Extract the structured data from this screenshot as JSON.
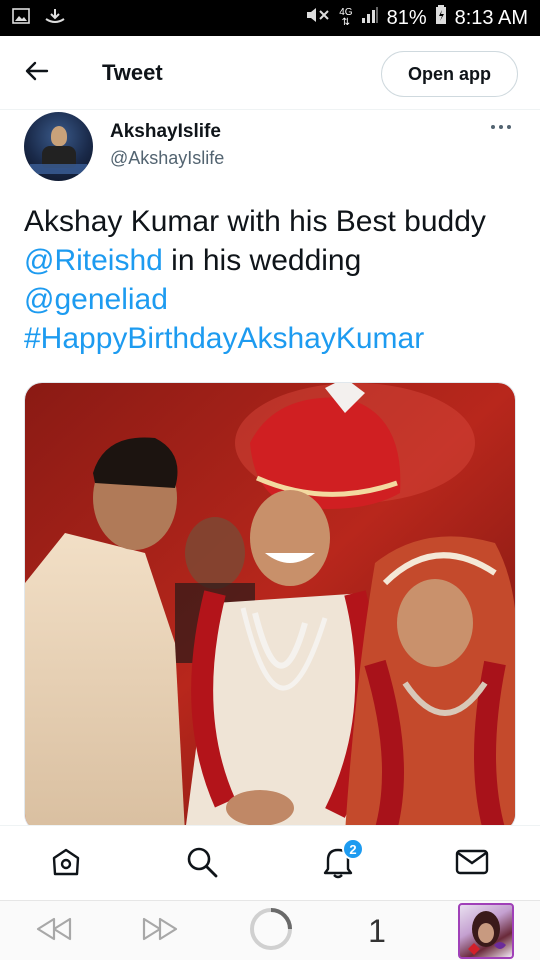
{
  "status_bar": {
    "battery_percent": "81%",
    "time": "8:13 AM",
    "network": "4G",
    "icons": [
      "image-icon",
      "download-icon",
      "mute-icon",
      "signal-icon",
      "battery-icon"
    ]
  },
  "header": {
    "back_icon": "arrow-left-icon",
    "title": "Tweet",
    "open_app_label": "Open app"
  },
  "author": {
    "name": "AkshayIslife",
    "handle": "@AkshayIslife",
    "more_icon": "ellipsis-icon"
  },
  "tweet": {
    "text_part1": "Akshay Kumar with his Best buddy ",
    "mention1": "@Riteishd",
    "text_part2": " in his wedding ",
    "mention2": "@geneliad",
    "hashtag": "#HappyBirthdayAkshayKumar"
  },
  "bottom_nav": {
    "items": [
      "home-icon",
      "search-icon",
      "notifications-icon",
      "messages-icon"
    ],
    "notification_count": "2"
  },
  "browser_bar": {
    "tab_count": "1",
    "items": [
      "back-icon",
      "forward-icon",
      "loading-icon"
    ]
  },
  "colors": {
    "accent": "#1d9bf0",
    "text": "#0f1419",
    "muted": "#536471"
  }
}
